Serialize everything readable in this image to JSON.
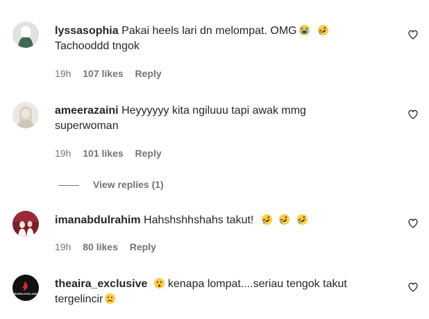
{
  "comments": [
    {
      "username": "lyssasophia",
      "text": "Pakai heels lari dn melompat. OMG",
      "text_cont": "Tachooddd tngok",
      "emojis": [
        "loudly-crying-face-emoji",
        "rolling-on-floor-laughing-emoji"
      ],
      "time": "19h",
      "likes": "107 likes",
      "reply": "Reply"
    },
    {
      "username": "ameerazaini",
      "text": "Heyyyyyy kita ngiluuu tapi awak mmg superwoman",
      "time": "19h",
      "likes": "101 likes",
      "reply": "Reply",
      "view_replies": "View replies (1)"
    },
    {
      "username": "imanabdulrahim",
      "text": "Hahshshhshahs takut!",
      "emojis": [
        "rolling-on-floor-laughing-emoji",
        "rolling-on-floor-laughing-emoji",
        "rolling-on-floor-laughing-emoji"
      ],
      "time": "19h",
      "likes": "80 likes",
      "reply": "Reply"
    },
    {
      "username": "theaira_exclusive",
      "text": "kenapa lompat....seriau tengok takut tergelincir",
      "emojis": [
        "frowning-face-emoji",
        "slightly-frowning-face-emoji"
      ],
      "avatar_text": "THEAIRA EXCLUSIVE"
    }
  ],
  "colors": {
    "text": "#262626",
    "secondary": "#737373",
    "emoji_yellow": "#ffcc4d"
  }
}
